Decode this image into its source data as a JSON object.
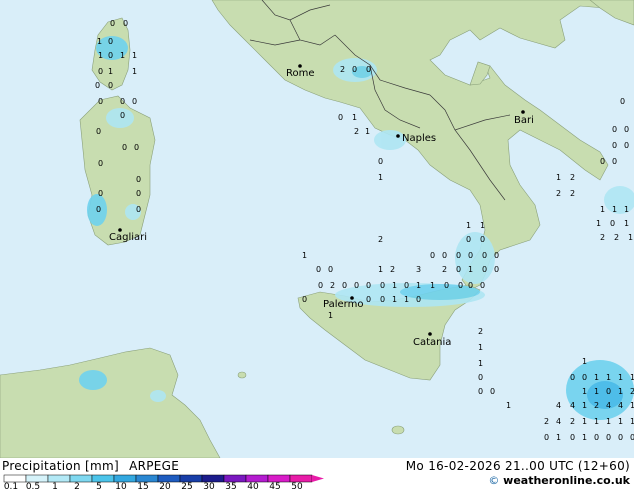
{
  "title": {
    "product": "Precipitation [mm]",
    "model": "ARPEGE",
    "datetime": "Mo 16-02-2026 21..00 UTC (12+60)"
  },
  "credit": {
    "symbol": "©",
    "text": "weatheronline.co.uk"
  },
  "colors": {
    "sea": "#d9eef9",
    "land": "#c8ddb0",
    "precip_light": "#aee6f3",
    "precip_mid": "#6fd2ee",
    "precip_heavy": "#40b8e8",
    "border": "#3a3a3a"
  },
  "cities": [
    {
      "name": "Rome"
    },
    {
      "name": "Naples"
    },
    {
      "name": "Bari"
    },
    {
      "name": "Cagliari"
    },
    {
      "name": "Palermo"
    },
    {
      "name": "Catania"
    }
  ],
  "legend": {
    "ticks": [
      "0.1",
      "0.5",
      "1",
      "2",
      "5",
      "10",
      "15",
      "20",
      "25",
      "30",
      "35",
      "40",
      "45",
      "50"
    ],
    "colors": [
      "#ffffff",
      "#d6f3fa",
      "#b3e9f6",
      "#7fd8f0",
      "#4cc4ea",
      "#33a8e0",
      "#2a87d2",
      "#1e5cc0",
      "#183ea8",
      "#1c1c8c",
      "#7a18c0",
      "#b41cd0",
      "#d81cc8",
      "#e81ca8"
    ]
  },
  "precip_labels": [
    "0",
    "0",
    "1",
    "0",
    "1",
    "0",
    "1",
    "1",
    "0",
    "1",
    "1",
    "0",
    "0",
    "0",
    "0",
    "0",
    "0",
    "0",
    "0",
    "0",
    "0",
    "0",
    "0",
    "0",
    "0",
    "0",
    "2",
    "0",
    "0",
    "0",
    "1",
    "2",
    "1",
    "0",
    "1",
    "2",
    "1",
    "1",
    "0",
    "0",
    "1",
    "0",
    "0",
    "0",
    "0",
    "0",
    "0",
    "0",
    "0",
    "1",
    "2",
    "3",
    "2",
    "0",
    "1",
    "0",
    "0",
    "0",
    "2",
    "0",
    "0",
    "0",
    "0",
    "1",
    "0",
    "1",
    "1",
    "0",
    "0",
    "0",
    "0",
    "0",
    "0",
    "0",
    "1",
    "1",
    "0",
    "1",
    "2",
    "1",
    "1",
    "0",
    "0",
    "0",
    "1",
    "1",
    "0",
    "0",
    "1",
    "1",
    "1",
    "1",
    "1",
    "1",
    "0",
    "1",
    "2",
    "4",
    "4",
    "1",
    "2",
    "4",
    "4",
    "1",
    "2",
    "4",
    "2",
    "1",
    "1",
    "1",
    "1",
    "1",
    "0",
    "1",
    "0",
    "1",
    "0",
    "0",
    "0",
    "0",
    "0",
    "0",
    "0",
    "0",
    "0",
    "0",
    "1",
    "2",
    "2",
    "2",
    "1",
    "1",
    "1",
    "1",
    "0",
    "1",
    "2",
    "2",
    "1",
    "0",
    "0",
    "0",
    "0",
    "0",
    "1",
    "1",
    "1",
    "0",
    "1",
    "0",
    "1",
    "1",
    "1",
    "0",
    "0"
  ]
}
